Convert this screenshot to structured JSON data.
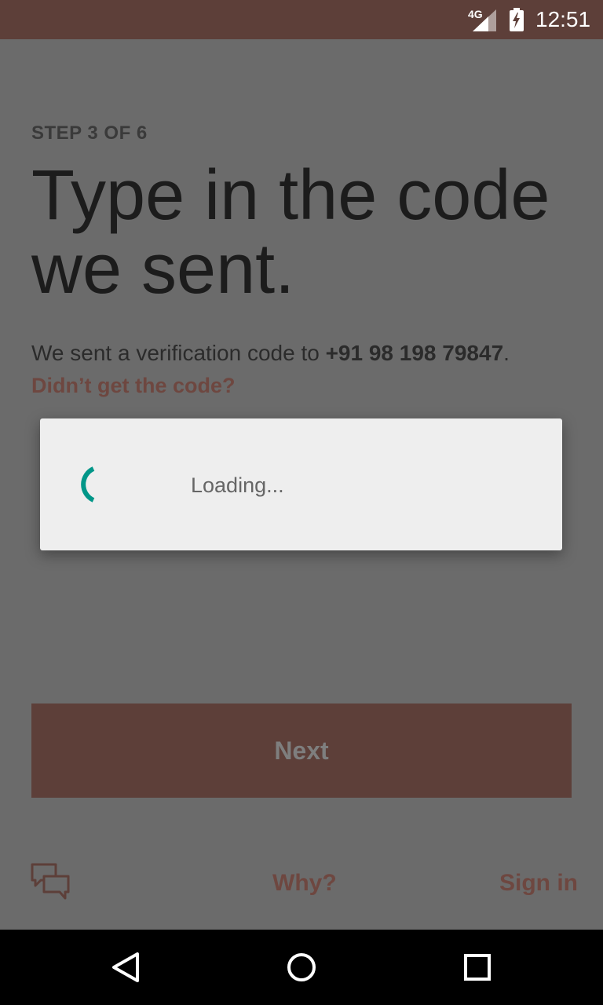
{
  "status_bar": {
    "network_label": "4G",
    "time": "12:51",
    "icons": [
      "signal-icon",
      "battery-charging-icon"
    ]
  },
  "screen": {
    "step_label": "STEP 3 OF 6",
    "title": "Type in the code we sent.",
    "description_prefix": "We sent a verification code to ",
    "phone_number": "+91 98 198 79847",
    "description_suffix": ".",
    "resend_link": "Didn’t get the code?",
    "next_button": "Next",
    "why_link": "Why?",
    "signin_link": "Sign in",
    "chat_icon": "chat-icon"
  },
  "dialog": {
    "loading_text": "Loading...",
    "spinner_color": "#009688"
  },
  "colors": {
    "accent": "#5d3f39",
    "link": "#6e4740"
  },
  "nav_bar": {
    "icons": [
      "back-icon",
      "home-icon",
      "recents-icon"
    ]
  }
}
